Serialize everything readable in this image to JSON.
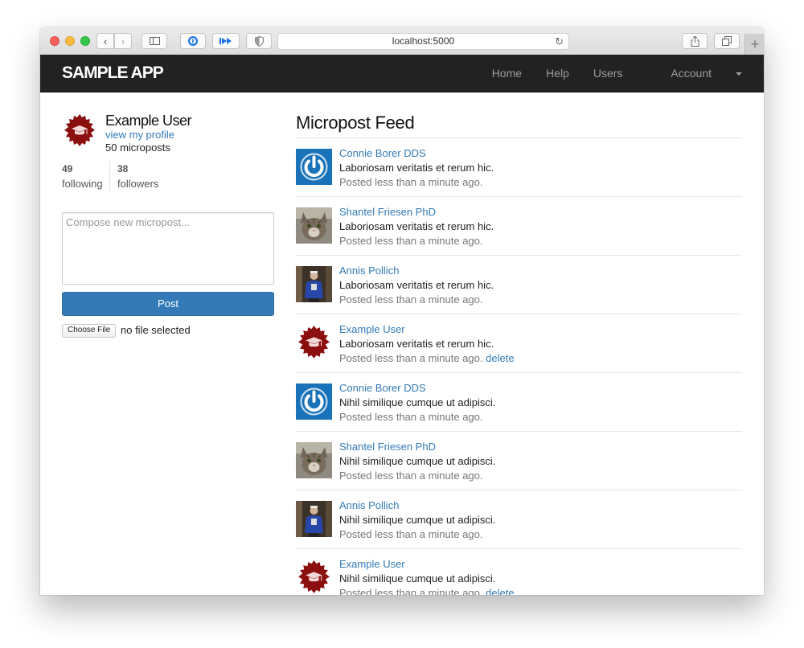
{
  "browser": {
    "url": "localhost:5000"
  },
  "navbar": {
    "logo": "SAMPLE APP",
    "links": [
      "Home",
      "Help",
      "Users",
      "Account"
    ]
  },
  "sidebar": {
    "name": "Example User",
    "profile_link": "view my profile",
    "microposts": "50 microposts",
    "following_count": "49",
    "following_label": "following",
    "followers_count": "38",
    "followers_label": "followers",
    "compose_placeholder": "Compose new micropost...",
    "post_button": "Post",
    "file_button": "Choose File",
    "file_status": "no file selected"
  },
  "feed": {
    "title": "Micropost Feed",
    "items": [
      {
        "user": "Connie Borer DDS",
        "content": "Laboriosam veritatis et rerum hic.",
        "timestamp": "Posted less than a minute ago.",
        "delete": "",
        "avatar": "power-icon"
      },
      {
        "user": "Shantel Friesen PhD",
        "content": "Laboriosam veritatis et rerum hic.",
        "timestamp": "Posted less than a minute ago.",
        "delete": "",
        "avatar": "cat-photo"
      },
      {
        "user": "Annis Pollich",
        "content": "Laboriosam veritatis et rerum hic.",
        "timestamp": "Posted less than a minute ago.",
        "delete": "",
        "avatar": "person-photo"
      },
      {
        "user": "Example User",
        "content": "Laboriosam veritatis et rerum hic.",
        "timestamp": "Posted less than a minute ago.",
        "delete": "delete",
        "avatar": "graduation-cap-badge"
      },
      {
        "user": "Connie Borer DDS",
        "content": "Nihil similique cumque ut adipisci.",
        "timestamp": "Posted less than a minute ago.",
        "delete": "",
        "avatar": "power-icon"
      },
      {
        "user": "Shantel Friesen PhD",
        "content": "Nihil similique cumque ut adipisci.",
        "timestamp": "Posted less than a minute ago.",
        "delete": "",
        "avatar": "cat-photo"
      },
      {
        "user": "Annis Pollich",
        "content": "Nihil similique cumque ut adipisci.",
        "timestamp": "Posted less than a minute ago.",
        "delete": "",
        "avatar": "person-photo"
      },
      {
        "user": "Example User",
        "content": "Nihil similique cumque ut adipisci.",
        "timestamp": "Posted less than a minute ago.",
        "delete": "delete",
        "avatar": "graduation-cap-badge"
      }
    ]
  },
  "colors": {
    "navbar": "#222222",
    "link": "#337ab7",
    "primary_button": "#337ab7",
    "badge": "#8b0f0f",
    "power_blue": "#1a73b8"
  }
}
